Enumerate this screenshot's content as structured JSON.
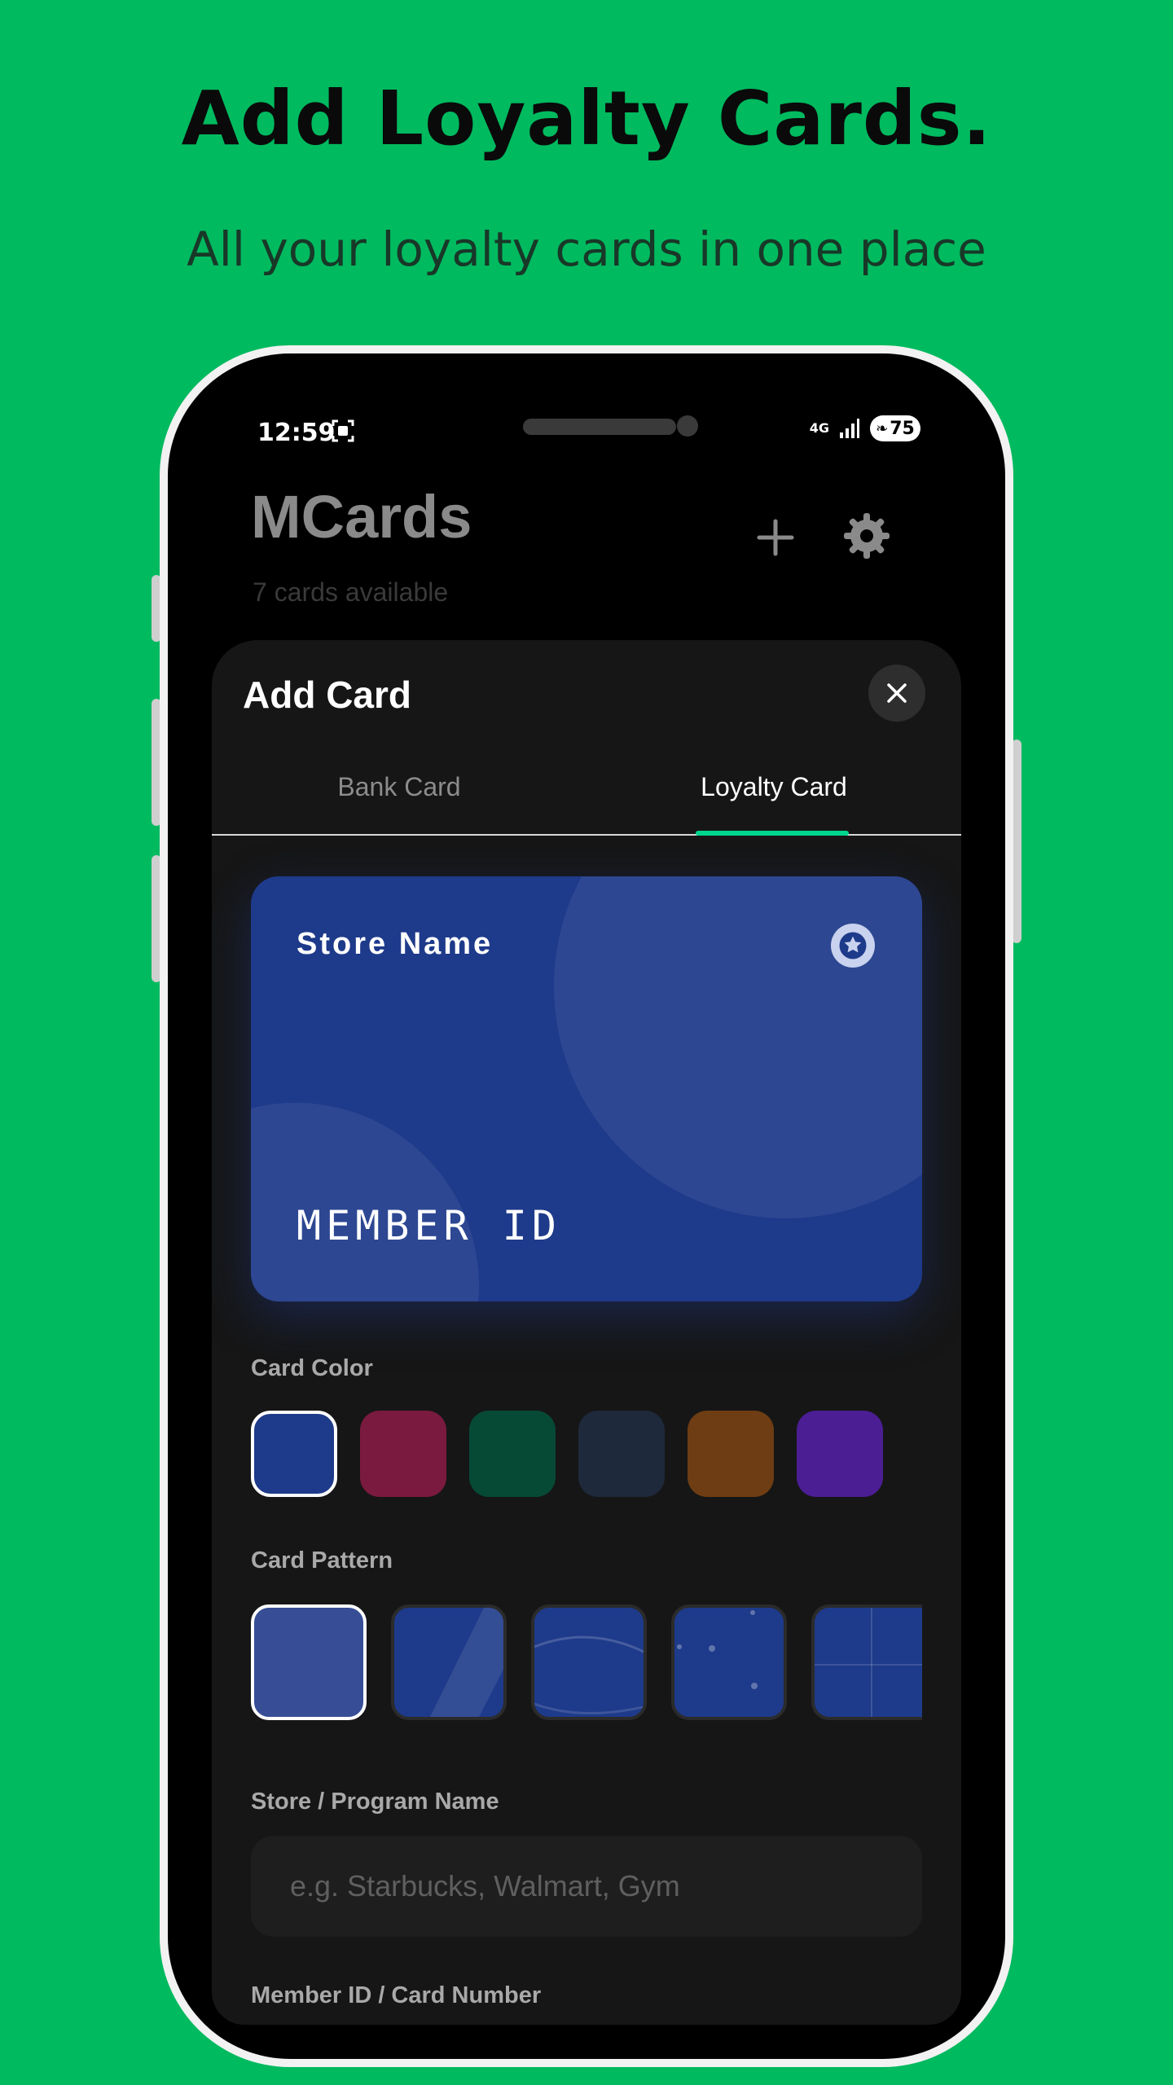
{
  "hero": {
    "title": "Add Loyalty Cards.",
    "subtitle": "All your loyalty cards in one place"
  },
  "status_bar": {
    "time": "12:59",
    "network": "4G",
    "battery": "75"
  },
  "app": {
    "title": "MCards",
    "cards_count": "7 cards available"
  },
  "sheet": {
    "title": "Add Card",
    "tabs": [
      {
        "label": "Bank Card",
        "active": false
      },
      {
        "label": "Loyalty Card",
        "active": true
      }
    ],
    "preview": {
      "store_name": "Store Name",
      "member_id": "MEMBER ID",
      "color": "#1E3A8A"
    },
    "card_color_label": "Card Color",
    "colors": [
      "#1E3A8A",
      "#7A1A3E",
      "#064A36",
      "#1E293B",
      "#6E3D13",
      "#4B1E94"
    ],
    "selected_color": "#1E3A8A",
    "card_pattern_label": "Card Pattern",
    "patterns": [
      "solid",
      "diagonal",
      "waves",
      "dots",
      "grid"
    ],
    "selected_pattern": "solid",
    "store_field_label": "Store / Program Name",
    "store_field_placeholder": "e.g. Starbucks, Walmart, Gym",
    "member_field_label": "Member ID / Card Number"
  },
  "colors": {
    "background": "#00BA5F",
    "accent": "#00D68F",
    "sheet": "#161616"
  }
}
